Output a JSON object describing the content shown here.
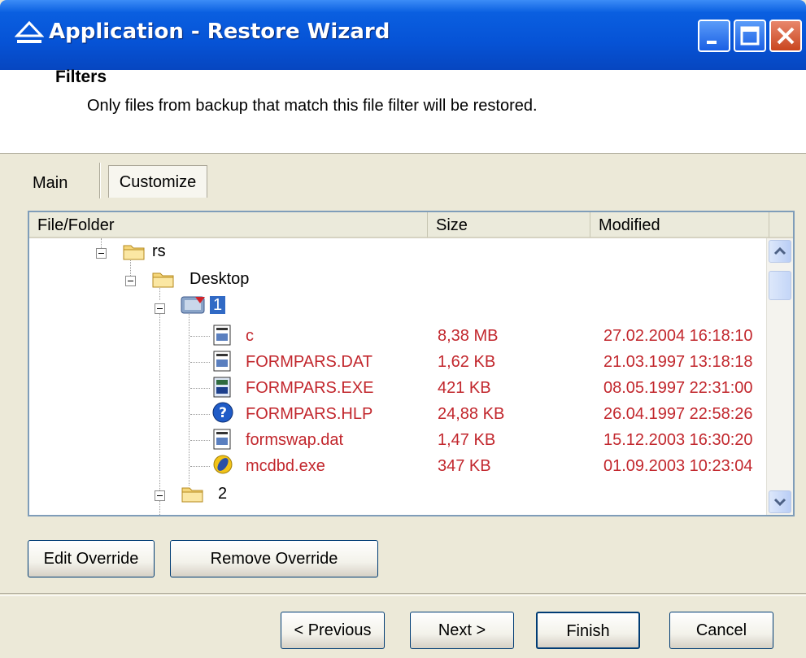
{
  "window": {
    "title": "Application - Restore Wizard"
  },
  "header": {
    "title": "Filters",
    "subtitle": "Only files from backup that match this file filter will be restored."
  },
  "tabs": [
    {
      "label": "Main"
    },
    {
      "label": "Customize"
    }
  ],
  "tree": {
    "columns": [
      "File/Folder",
      "Size",
      "Modified"
    ],
    "nodes": [
      {
        "label": "rs"
      },
      {
        "label": "Desktop"
      },
      {
        "label": "1"
      },
      {
        "label": "2"
      }
    ],
    "files": [
      {
        "name": "c",
        "size": "8,38 MB",
        "modified": "27.02.2004 16:18:10",
        "icon": "document-icon"
      },
      {
        "name": "FORMPARS.DAT",
        "size": "1,62 KB",
        "modified": "21.03.1997 13:18:18",
        "icon": "document-icon"
      },
      {
        "name": "FORMPARS.EXE",
        "size": "421 KB",
        "modified": "08.05.1997 22:31:00",
        "icon": "executable-icon"
      },
      {
        "name": "FORMPARS.HLP",
        "size": "24,88 KB",
        "modified": "26.04.1997 22:58:26",
        "icon": "help-icon"
      },
      {
        "name": "formswap.dat",
        "size": "1,47 KB",
        "modified": "15.12.2003 16:30:20",
        "icon": "document-icon"
      },
      {
        "name": "mcdbd.exe",
        "size": "347 KB",
        "modified": "01.09.2003 10:23:04",
        "icon": "app-icon"
      }
    ]
  },
  "buttons": {
    "edit_override": "Edit Override",
    "remove_override": "Remove Override",
    "previous": "< Previous",
    "next": "Next >",
    "finish": "Finish",
    "cancel": "Cancel"
  },
  "colors": {
    "title_bar": "#0653d6",
    "file_text": "#c2272d",
    "selection": "#316ac5",
    "dialog_bg": "#ece9d8"
  }
}
